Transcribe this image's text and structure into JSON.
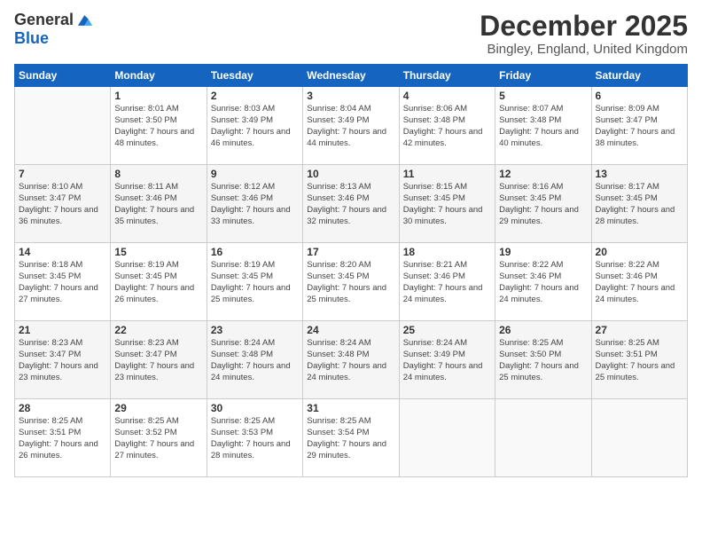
{
  "logo": {
    "general": "General",
    "blue": "Blue"
  },
  "title": "December 2025",
  "location": "Bingley, England, United Kingdom",
  "headers": [
    "Sunday",
    "Monday",
    "Tuesday",
    "Wednesday",
    "Thursday",
    "Friday",
    "Saturday"
  ],
  "weeks": [
    [
      {
        "day": "",
        "sunrise": "",
        "sunset": "",
        "daylight": ""
      },
      {
        "day": "1",
        "sunrise": "Sunrise: 8:01 AM",
        "sunset": "Sunset: 3:50 PM",
        "daylight": "Daylight: 7 hours and 48 minutes."
      },
      {
        "day": "2",
        "sunrise": "Sunrise: 8:03 AM",
        "sunset": "Sunset: 3:49 PM",
        "daylight": "Daylight: 7 hours and 46 minutes."
      },
      {
        "day": "3",
        "sunrise": "Sunrise: 8:04 AM",
        "sunset": "Sunset: 3:49 PM",
        "daylight": "Daylight: 7 hours and 44 minutes."
      },
      {
        "day": "4",
        "sunrise": "Sunrise: 8:06 AM",
        "sunset": "Sunset: 3:48 PM",
        "daylight": "Daylight: 7 hours and 42 minutes."
      },
      {
        "day": "5",
        "sunrise": "Sunrise: 8:07 AM",
        "sunset": "Sunset: 3:48 PM",
        "daylight": "Daylight: 7 hours and 40 minutes."
      },
      {
        "day": "6",
        "sunrise": "Sunrise: 8:09 AM",
        "sunset": "Sunset: 3:47 PM",
        "daylight": "Daylight: 7 hours and 38 minutes."
      }
    ],
    [
      {
        "day": "7",
        "sunrise": "Sunrise: 8:10 AM",
        "sunset": "Sunset: 3:47 PM",
        "daylight": "Daylight: 7 hours and 36 minutes."
      },
      {
        "day": "8",
        "sunrise": "Sunrise: 8:11 AM",
        "sunset": "Sunset: 3:46 PM",
        "daylight": "Daylight: 7 hours and 35 minutes."
      },
      {
        "day": "9",
        "sunrise": "Sunrise: 8:12 AM",
        "sunset": "Sunset: 3:46 PM",
        "daylight": "Daylight: 7 hours and 33 minutes."
      },
      {
        "day": "10",
        "sunrise": "Sunrise: 8:13 AM",
        "sunset": "Sunset: 3:46 PM",
        "daylight": "Daylight: 7 hours and 32 minutes."
      },
      {
        "day": "11",
        "sunrise": "Sunrise: 8:15 AM",
        "sunset": "Sunset: 3:45 PM",
        "daylight": "Daylight: 7 hours and 30 minutes."
      },
      {
        "day": "12",
        "sunrise": "Sunrise: 8:16 AM",
        "sunset": "Sunset: 3:45 PM",
        "daylight": "Daylight: 7 hours and 29 minutes."
      },
      {
        "day": "13",
        "sunrise": "Sunrise: 8:17 AM",
        "sunset": "Sunset: 3:45 PM",
        "daylight": "Daylight: 7 hours and 28 minutes."
      }
    ],
    [
      {
        "day": "14",
        "sunrise": "Sunrise: 8:18 AM",
        "sunset": "Sunset: 3:45 PM",
        "daylight": "Daylight: 7 hours and 27 minutes."
      },
      {
        "day": "15",
        "sunrise": "Sunrise: 8:19 AM",
        "sunset": "Sunset: 3:45 PM",
        "daylight": "Daylight: 7 hours and 26 minutes."
      },
      {
        "day": "16",
        "sunrise": "Sunrise: 8:19 AM",
        "sunset": "Sunset: 3:45 PM",
        "daylight": "Daylight: 7 hours and 25 minutes."
      },
      {
        "day": "17",
        "sunrise": "Sunrise: 8:20 AM",
        "sunset": "Sunset: 3:45 PM",
        "daylight": "Daylight: 7 hours and 25 minutes."
      },
      {
        "day": "18",
        "sunrise": "Sunrise: 8:21 AM",
        "sunset": "Sunset: 3:46 PM",
        "daylight": "Daylight: 7 hours and 24 minutes."
      },
      {
        "day": "19",
        "sunrise": "Sunrise: 8:22 AM",
        "sunset": "Sunset: 3:46 PM",
        "daylight": "Daylight: 7 hours and 24 minutes."
      },
      {
        "day": "20",
        "sunrise": "Sunrise: 8:22 AM",
        "sunset": "Sunset: 3:46 PM",
        "daylight": "Daylight: 7 hours and 24 minutes."
      }
    ],
    [
      {
        "day": "21",
        "sunrise": "Sunrise: 8:23 AM",
        "sunset": "Sunset: 3:47 PM",
        "daylight": "Daylight: 7 hours and 23 minutes."
      },
      {
        "day": "22",
        "sunrise": "Sunrise: 8:23 AM",
        "sunset": "Sunset: 3:47 PM",
        "daylight": "Daylight: 7 hours and 23 minutes."
      },
      {
        "day": "23",
        "sunrise": "Sunrise: 8:24 AM",
        "sunset": "Sunset: 3:48 PM",
        "daylight": "Daylight: 7 hours and 24 minutes."
      },
      {
        "day": "24",
        "sunrise": "Sunrise: 8:24 AM",
        "sunset": "Sunset: 3:48 PM",
        "daylight": "Daylight: 7 hours and 24 minutes."
      },
      {
        "day": "25",
        "sunrise": "Sunrise: 8:24 AM",
        "sunset": "Sunset: 3:49 PM",
        "daylight": "Daylight: 7 hours and 24 minutes."
      },
      {
        "day": "26",
        "sunrise": "Sunrise: 8:25 AM",
        "sunset": "Sunset: 3:50 PM",
        "daylight": "Daylight: 7 hours and 25 minutes."
      },
      {
        "day": "27",
        "sunrise": "Sunrise: 8:25 AM",
        "sunset": "Sunset: 3:51 PM",
        "daylight": "Daylight: 7 hours and 25 minutes."
      }
    ],
    [
      {
        "day": "28",
        "sunrise": "Sunrise: 8:25 AM",
        "sunset": "Sunset: 3:51 PM",
        "daylight": "Daylight: 7 hours and 26 minutes."
      },
      {
        "day": "29",
        "sunrise": "Sunrise: 8:25 AM",
        "sunset": "Sunset: 3:52 PM",
        "daylight": "Daylight: 7 hours and 27 minutes."
      },
      {
        "day": "30",
        "sunrise": "Sunrise: 8:25 AM",
        "sunset": "Sunset: 3:53 PM",
        "daylight": "Daylight: 7 hours and 28 minutes."
      },
      {
        "day": "31",
        "sunrise": "Sunrise: 8:25 AM",
        "sunset": "Sunset: 3:54 PM",
        "daylight": "Daylight: 7 hours and 29 minutes."
      },
      {
        "day": "",
        "sunrise": "",
        "sunset": "",
        "daylight": ""
      },
      {
        "day": "",
        "sunrise": "",
        "sunset": "",
        "daylight": ""
      },
      {
        "day": "",
        "sunrise": "",
        "sunset": "",
        "daylight": ""
      }
    ]
  ]
}
